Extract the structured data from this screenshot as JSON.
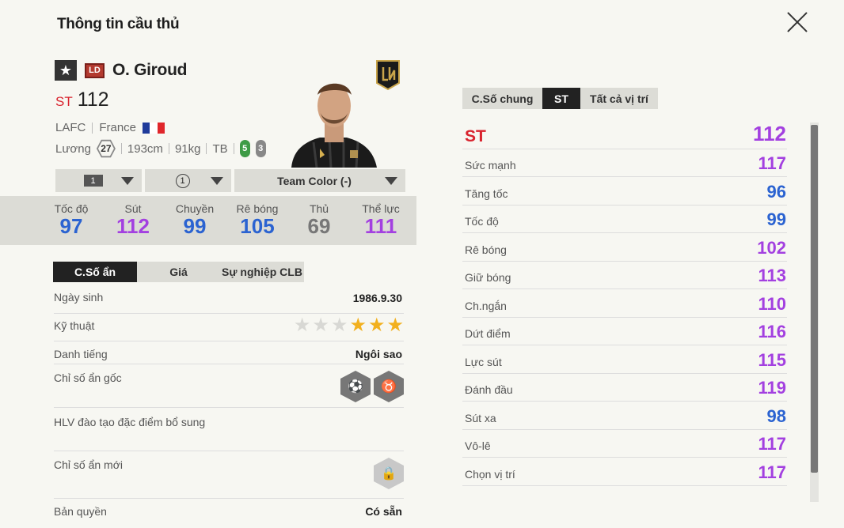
{
  "window": {
    "title": "Thông tin cầu thủ"
  },
  "colors": {
    "red": "#d9232e",
    "purple": "#a340e0",
    "blue": "#2b63d1",
    "gray": "#777777"
  },
  "player": {
    "season_badge": "LD",
    "name": "O. Giroud",
    "position": "ST",
    "ovr": "112",
    "club": "LAFC",
    "nation": "France",
    "salary_label": "Lương",
    "salary": "27",
    "height": "193cm",
    "weight": "91kg",
    "body_type": "TB",
    "left_foot": "5",
    "right_foot": "3"
  },
  "dropdowns": {
    "level": "1",
    "training": "1",
    "team_color": "Team Color (-)"
  },
  "summary": [
    {
      "label": "Tốc độ",
      "value": "97",
      "color": "blue"
    },
    {
      "label": "Sút",
      "value": "112",
      "color": "purple"
    },
    {
      "label": "Chuyền",
      "value": "99",
      "color": "blue"
    },
    {
      "label": "Rê bóng",
      "value": "105",
      "color": "blue"
    },
    {
      "label": "Thủ",
      "value": "69",
      "color": "gray"
    },
    {
      "label": "Thể lực",
      "value": "111",
      "color": "purple"
    }
  ],
  "left_tabs": [
    "C.Số ẩn",
    "Giá",
    "Sự nghiệp CLB"
  ],
  "hidden": {
    "dob_label": "Ngày sinh",
    "dob": "1986.9.30",
    "skill_label": "Kỹ thuật",
    "skill_stars": 3,
    "fame_label": "Danh tiếng",
    "fame": "Ngôi sao",
    "orig_traits_label": "Chỉ số ẩn gốc",
    "coach_label": "HLV đào tạo đặc điểm bổ sung",
    "new_traits_label": "Chỉ số ẩn mới",
    "license_label": "Bản quyền",
    "license": "Có sẵn"
  },
  "right_tabs": [
    "C.Số chung",
    "ST",
    "Tất cả vị trí"
  ],
  "attributes": [
    {
      "label": "ST",
      "value": "112",
      "color": "purple"
    },
    {
      "label": "Sức mạnh",
      "value": "117",
      "color": "purple"
    },
    {
      "label": "Tăng tốc",
      "value": "96",
      "color": "blue"
    },
    {
      "label": "Tốc độ",
      "value": "99",
      "color": "blue"
    },
    {
      "label": "Rê bóng",
      "value": "102",
      "color": "purple"
    },
    {
      "label": "Giữ bóng",
      "value": "113",
      "color": "purple"
    },
    {
      "label": "Ch.ngắn",
      "value": "110",
      "color": "purple"
    },
    {
      "label": "Dứt điểm",
      "value": "116",
      "color": "purple"
    },
    {
      "label": "Lực sút",
      "value": "115",
      "color": "purple"
    },
    {
      "label": "Đánh đầu",
      "value": "119",
      "color": "purple"
    },
    {
      "label": "Sút xa",
      "value": "98",
      "color": "blue"
    },
    {
      "label": "Vô-lê",
      "value": "117",
      "color": "purple"
    },
    {
      "label": "Chọn vị trí",
      "value": "117",
      "color": "purple"
    }
  ]
}
